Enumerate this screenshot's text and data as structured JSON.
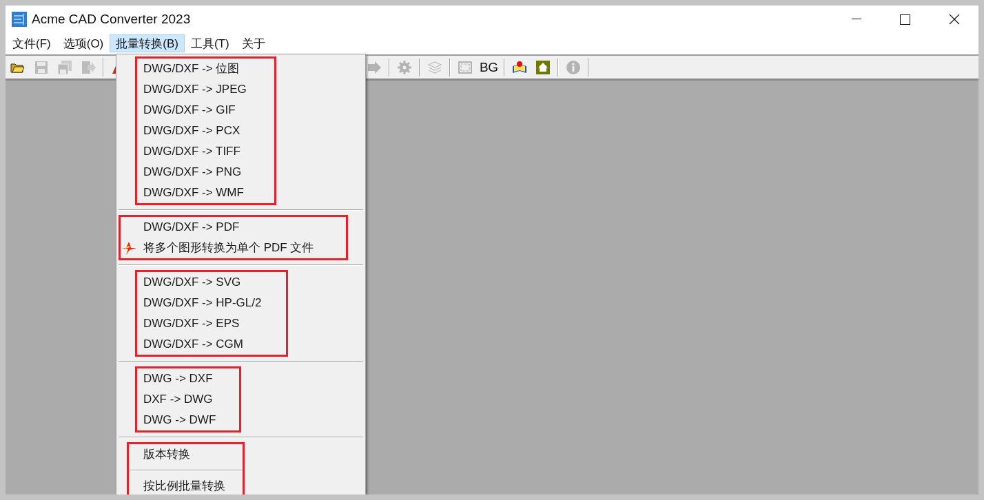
{
  "window": {
    "title": "Acme CAD Converter 2023"
  },
  "menu_bar": [
    {
      "label": "文件(F)",
      "selected": false
    },
    {
      "label": "选项(O)",
      "selected": false
    },
    {
      "label": "批量转换(B)",
      "selected": true
    },
    {
      "label": "工具(T)",
      "selected": false
    },
    {
      "label": "关于",
      "selected": false
    }
  ],
  "toolbar": {
    "left": [
      {
        "kind": "open-folder",
        "disabled": false
      },
      {
        "kind": "save",
        "disabled": true
      },
      {
        "kind": "save-all",
        "disabled": true
      },
      {
        "kind": "export",
        "disabled": true
      },
      {
        "kind": "separator"
      },
      {
        "kind": "convert",
        "disabled": false
      }
    ],
    "right": [
      {
        "kind": "arrow",
        "disabled": true
      },
      {
        "kind": "separator"
      },
      {
        "kind": "gear",
        "disabled": true
      },
      {
        "kind": "separator"
      },
      {
        "kind": "layers",
        "disabled": true
      },
      {
        "kind": "separator"
      },
      {
        "kind": "grid",
        "disabled": false
      },
      {
        "kind": "text",
        "label": "BG",
        "disabled": false
      },
      {
        "kind": "separator"
      },
      {
        "kind": "help",
        "disabled": false
      },
      {
        "kind": "home",
        "disabled": false
      },
      {
        "kind": "separator"
      },
      {
        "kind": "info",
        "disabled": true
      },
      {
        "kind": "separator"
      }
    ]
  },
  "dropdown": {
    "sections": [
      {
        "boxed": true,
        "items": [
          {
            "kind": "item",
            "label": "DWG/DXF -> 位图"
          },
          {
            "kind": "item",
            "label": "DWG/DXF -> JPEG"
          },
          {
            "kind": "item",
            "label": "DWG/DXF -> GIF"
          },
          {
            "kind": "item",
            "label": "DWG/DXF -> PCX"
          },
          {
            "kind": "item",
            "label": "DWG/DXF -> TIFF"
          },
          {
            "kind": "item",
            "label": "DWG/DXF -> PNG"
          },
          {
            "kind": "item",
            "label": "DWG/DXF -> WMF"
          }
        ]
      },
      {
        "boxed": true,
        "items": [
          {
            "kind": "item",
            "label": "DWG/DXF -> PDF"
          },
          {
            "kind": "icon-item",
            "label": "将多个图形转换为单个 PDF 文件"
          }
        ]
      },
      {
        "boxed": true,
        "items": [
          {
            "kind": "item",
            "label": "DWG/DXF -> SVG"
          },
          {
            "kind": "item",
            "label": "DWG/DXF -> HP-GL/2"
          },
          {
            "kind": "item",
            "label": "DWG/DXF -> EPS"
          },
          {
            "kind": "item",
            "label": "DWG/DXF -> CGM"
          }
        ]
      },
      {
        "boxed": true,
        "items": [
          {
            "kind": "item",
            "label": "DWG -> DXF"
          },
          {
            "kind": "item",
            "label": "DXF -> DWG"
          },
          {
            "kind": "item",
            "label": "DWG -> DWF"
          }
        ]
      },
      {
        "boxed": true,
        "items": [
          {
            "kind": "item",
            "label": "版本转换"
          },
          {
            "kind": "separator"
          },
          {
            "kind": "item",
            "label": "按比例批量转换"
          }
        ]
      }
    ]
  }
}
